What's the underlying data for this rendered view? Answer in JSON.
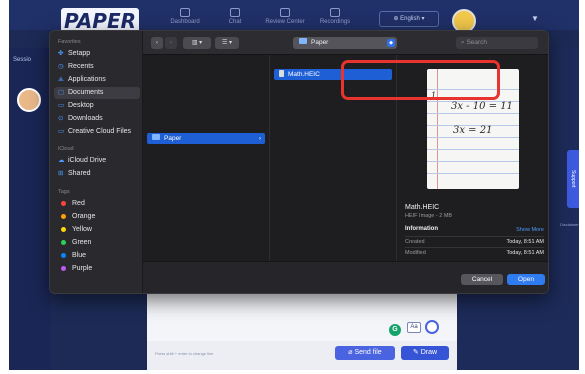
{
  "app": {
    "logo": "PAPER",
    "nav": [
      "Dashboard",
      "Chat",
      "Review Center",
      "Recordings"
    ],
    "language": "English",
    "sessions_label": "Sessio",
    "support_label": "Support",
    "disclaimer": "Disclaimer"
  },
  "chat": {
    "hint": "Press shift + enter to change line",
    "send_file": "Send file",
    "draw": "Draw",
    "grammarly": "G",
    "font_toggle": "Aa"
  },
  "dialog": {
    "sidebar": {
      "favorites_heading": "Favorites",
      "favorites": [
        {
          "label": "Setapp",
          "icon": "setapp-icon"
        },
        {
          "label": "Recents",
          "icon": "clock-icon"
        },
        {
          "label": "Applications",
          "icon": "applications-icon"
        },
        {
          "label": "Documents",
          "icon": "document-icon"
        },
        {
          "label": "Desktop",
          "icon": "desktop-icon"
        },
        {
          "label": "Downloads",
          "icon": "download-icon"
        },
        {
          "label": "Creative Cloud Files",
          "icon": "folder-icon"
        }
      ],
      "icloud_heading": "iCloud",
      "icloud": [
        {
          "label": "iCloud Drive",
          "icon": "cloud-icon"
        },
        {
          "label": "Shared",
          "icon": "shared-folder-icon"
        }
      ],
      "tags_heading": "Tags",
      "tags": [
        {
          "label": "Red",
          "color": "#ff453a"
        },
        {
          "label": "Orange",
          "color": "#ff9f0a"
        },
        {
          "label": "Yellow",
          "color": "#ffd60a"
        },
        {
          "label": "Green",
          "color": "#30d158"
        },
        {
          "label": "Blue",
          "color": "#0a84ff"
        },
        {
          "label": "Purple",
          "color": "#bf5af2"
        }
      ]
    },
    "toolbar": {
      "location": "Paper",
      "search_placeholder": "Search"
    },
    "column1_item": "Paper",
    "column2_item": "Math.HEIC",
    "preview": {
      "handwriting_1": "3x - 10 = 11",
      "handwriting_2": "3x = 21",
      "handwriting_marker": "1",
      "file_name": "Math.HEIC",
      "file_meta": "HEIF Image - 2 MB",
      "info_heading": "Information",
      "show_more": "Show More",
      "rows": [
        {
          "label": "Created",
          "value": "Today, 8:51 AM"
        },
        {
          "label": "Modified",
          "value": "Today, 8:51 AM"
        }
      ]
    },
    "buttons": {
      "cancel": "Cancel",
      "open": "Open"
    }
  },
  "colors": {
    "accent": "#2f7bf0",
    "highlight": "#e8332e",
    "app_background": "#1c2a55"
  }
}
